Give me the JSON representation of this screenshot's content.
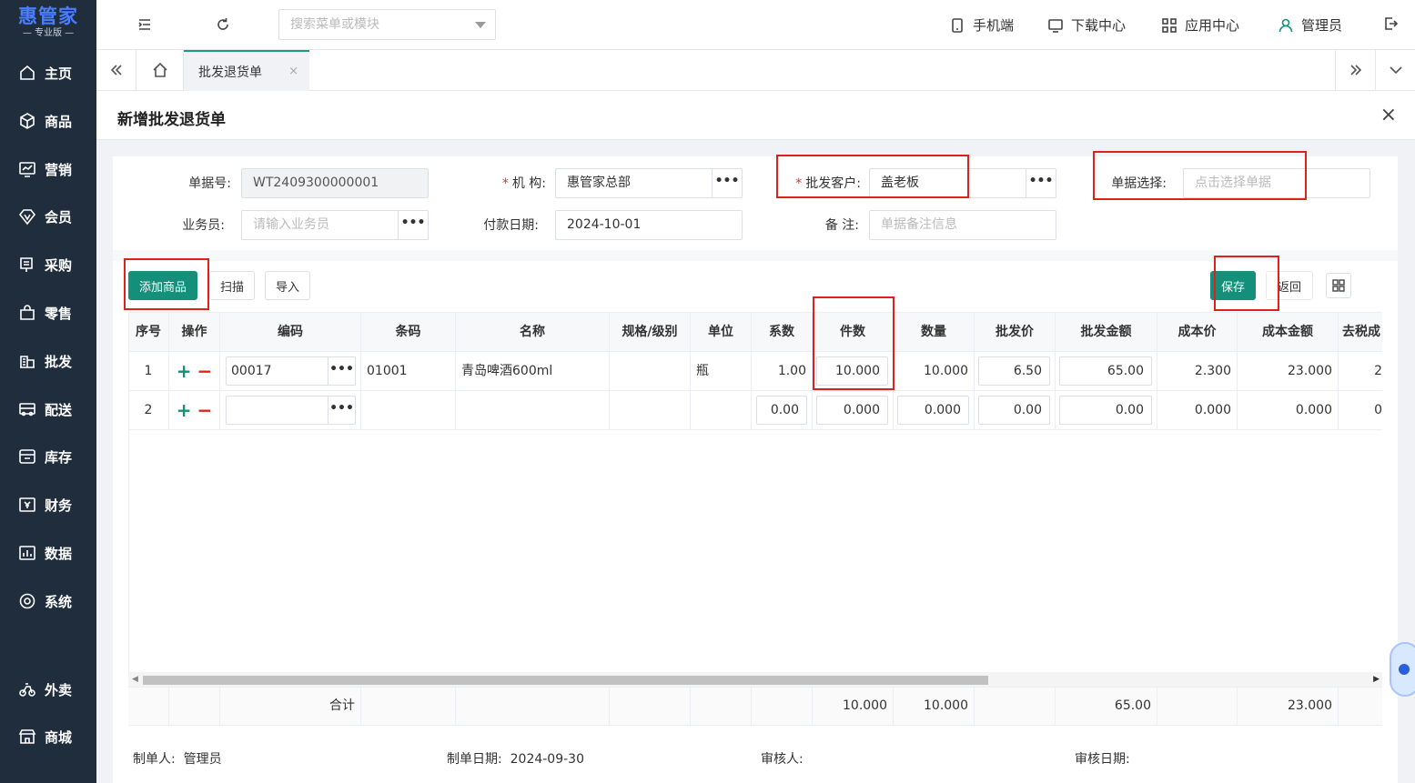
{
  "brand": {
    "name": "惠管家",
    "edition": "专业版"
  },
  "sidebar": {
    "items": [
      {
        "label": "主页",
        "icon": "home-icon"
      },
      {
        "label": "商品",
        "icon": "box-icon"
      },
      {
        "label": "营销",
        "icon": "chart-icon"
      },
      {
        "label": "会员",
        "icon": "diamond-icon"
      },
      {
        "label": "采购",
        "icon": "purchase-icon"
      },
      {
        "label": "零售",
        "icon": "bag-icon"
      },
      {
        "label": "批发",
        "icon": "building-icon"
      },
      {
        "label": "配送",
        "icon": "truck-icon"
      },
      {
        "label": "库存",
        "icon": "inbox-icon"
      },
      {
        "label": "财务",
        "icon": "yen-icon"
      },
      {
        "label": "数据",
        "icon": "bar-chart-icon"
      },
      {
        "label": "系统",
        "icon": "settings-icon"
      },
      {
        "label": "外卖",
        "icon": "bike-icon"
      },
      {
        "label": "商城",
        "icon": "store-icon"
      }
    ]
  },
  "topbar": {
    "search_placeholder": "搜索菜单或模块",
    "mobile": "手机端",
    "download": "下载中心",
    "apps": "应用中心",
    "user": "管理员"
  },
  "tabs": {
    "active": "批发退货单",
    "close": "×"
  },
  "page": {
    "title": "新增批发退货单",
    "close": "×"
  },
  "form": {
    "doc_no_label": "单据号:",
    "doc_no": "WT2409300000001",
    "org_label": "机 构:",
    "org": "惠管家总部",
    "customer_label": "批发客户:",
    "customer": "盖老板",
    "doc_select_label": "单据选择:",
    "doc_select_placeholder": "点击选择单据",
    "salesman_label": "业务员:",
    "salesman_placeholder": "请输入业务员",
    "pay_date_label": "付款日期:",
    "pay_date": "2024-10-01",
    "remark_label": "备 注:",
    "remark_placeholder": "单据备注信息",
    "required_mark": "*",
    "dots": "•••"
  },
  "toolbar": {
    "add": "添加商品",
    "scan": "扫描",
    "import": "导入",
    "save": "保存",
    "back": "返回"
  },
  "grid": {
    "columns": [
      "序号",
      "操作",
      "编码",
      "条码",
      "名称",
      "规格/级别",
      "单位",
      "系数",
      "件数",
      "数量",
      "批发价",
      "批发金额",
      "成本价",
      "成本金额",
      "去税成"
    ],
    "rows": [
      {
        "no": "1",
        "code": "00017",
        "barcode": "01001",
        "name": "青岛啤酒600ml",
        "spec": "",
        "unit": "瓶",
        "factor": "1.00",
        "pieces": "10.000",
        "qty": "10.000",
        "price": "6.50",
        "amount": "65.00",
        "cost": "2.300",
        "cost_amount": "23.000",
        "tax_cost": "2"
      },
      {
        "no": "2",
        "code": "",
        "barcode": "",
        "name": "",
        "spec": "",
        "unit": "",
        "factor": "0.00",
        "pieces": "0.000",
        "qty": "0.000",
        "price": "0.00",
        "amount": "0.00",
        "cost": "0.000",
        "cost_amount": "0.000",
        "tax_cost": "0"
      }
    ],
    "total_label": "合计",
    "totals": {
      "pieces": "10.000",
      "qty": "10.000",
      "amount": "65.00",
      "cost_amount": "23.000"
    },
    "op_plus": "+",
    "op_minus": "−"
  },
  "footer": {
    "maker_label": "制单人:",
    "maker": "管理员",
    "make_date_label": "制单日期:",
    "make_date": "2024-09-30",
    "reviewer_label": "审核人:",
    "review_date_label": "审核日期:"
  }
}
